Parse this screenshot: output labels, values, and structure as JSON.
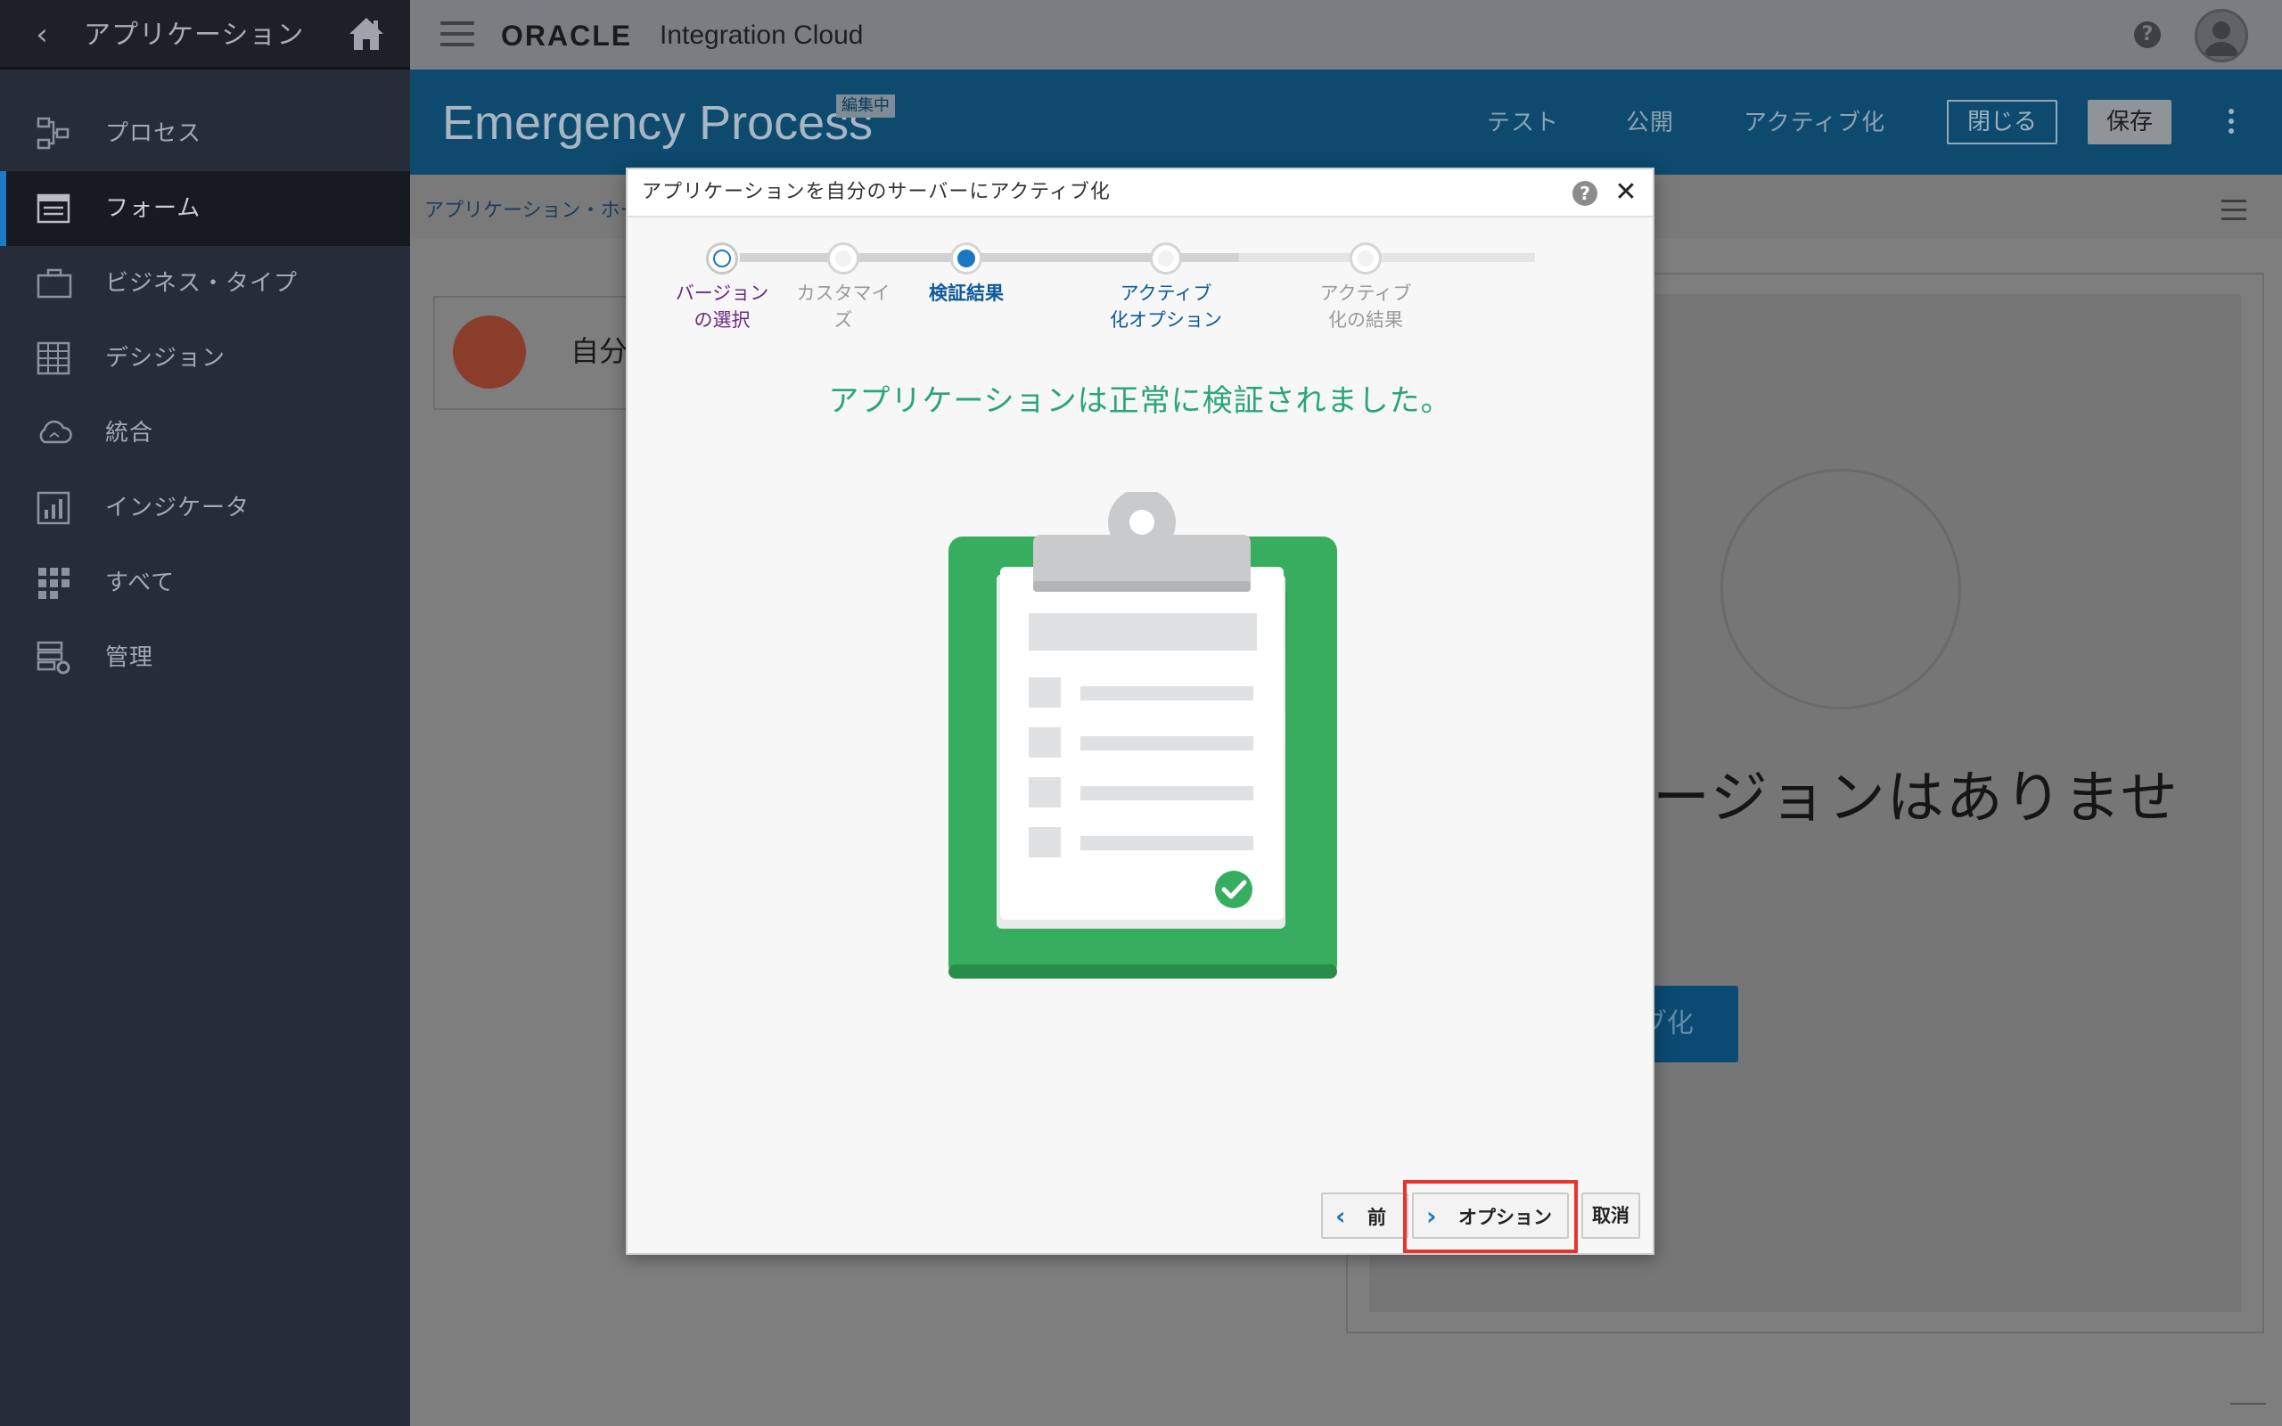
{
  "sidebar": {
    "title": "アプリケーション",
    "items": [
      {
        "label": "プロセス",
        "icon": "process-icon"
      },
      {
        "label": "フォーム",
        "icon": "form-icon",
        "active": true
      },
      {
        "label": "ビジネス・タイプ",
        "icon": "briefcase-icon"
      },
      {
        "label": "デシジョン",
        "icon": "table-grid-icon"
      },
      {
        "label": "統合",
        "icon": "cloud-icon"
      },
      {
        "label": "インジケータ",
        "icon": "chart-icon"
      },
      {
        "label": "すべて",
        "icon": "apps-grid-icon"
      },
      {
        "label": "管理",
        "icon": "server-gear-icon"
      }
    ]
  },
  "topbar": {
    "logo": "ORACLE",
    "product": "Integration Cloud",
    "help": "?"
  },
  "project": {
    "title": "Emergency Process",
    "badge": "編集中",
    "links": {
      "test": "テスト",
      "publish": "公開",
      "activate": "アクティブ化"
    },
    "close_label": "閉じる",
    "save_label": "保存"
  },
  "background": {
    "breadcrumb": "アプリケーション・ホー",
    "card_text": "自分の",
    "big_text": "ージョンはありませ",
    "button_text": "ブ化"
  },
  "dialog": {
    "title": "アプリケーションを自分のサーバーにアクティブ化",
    "help": "?",
    "close": "✕",
    "steps": [
      {
        "label": "バージョン\nの選択",
        "state": "visited"
      },
      {
        "label": "カスタマイ\nズ",
        "state": "future"
      },
      {
        "label": "検証結果",
        "state": "current"
      },
      {
        "label": "アクティブ\n化オプション",
        "state": "next"
      },
      {
        "label": "アクティブ\n化の結果",
        "state": "future"
      }
    ],
    "message": "アプリケーションは正常に検証されました。",
    "buttons": {
      "prev": "前",
      "next": "オプション",
      "cancel": "取消"
    }
  },
  "colors": {
    "accent": "#1c77c3",
    "success_text": "#2aa57a",
    "clipboard_green": "#36ad5f",
    "highlight_red": "#e8342c",
    "sidebar_bg": "#272c3a",
    "header_blue": "#0d4a6e"
  }
}
